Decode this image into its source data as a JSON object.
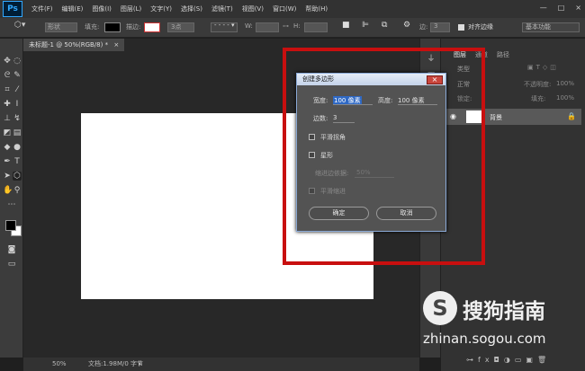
{
  "app": {
    "logo": "Ps",
    "menu": [
      "文件(F)",
      "编辑(E)",
      "图像(I)",
      "图层(L)",
      "文字(Y)",
      "选择(S)",
      "滤镜(T)",
      "视图(V)",
      "窗口(W)",
      "帮助(H)"
    ],
    "window_controls": [
      "—",
      "□",
      "×"
    ]
  },
  "options_bar": {
    "mode_value": "形状",
    "fill_label": "填充:",
    "stroke_label": "描边:",
    "stroke_width": "3点",
    "w_label": "W:",
    "h_label": "H:",
    "edge_label": "边:",
    "edge_value": "3",
    "align_edges_label": "对齐边缘",
    "workspace": "基本功能",
    "fill_color": "#000000"
  },
  "document": {
    "tab_title": "未标题-1 @ 50%(RGB/8) *",
    "tab_close": "×",
    "canvas_color": "#ffffff",
    "zoom": "50%",
    "doc_info": "文档:1.98M/0 字节"
  },
  "panels": {
    "tabs": [
      "图层",
      "通道",
      "路径"
    ],
    "kind_label": "类型",
    "blend_mode": "正常",
    "opacity_label": "不透明度:",
    "opacity_value": "100%",
    "lock_label": "锁定:",
    "fill_label": "填充:",
    "fill_value": "100%",
    "layer_name": "背景"
  },
  "dialog": {
    "title": "创建多边形",
    "close": "×",
    "width_label": "宽度:",
    "width_value": "100 像素",
    "height_label": "高度:",
    "height_value": "100 像素",
    "sides_label": "边数:",
    "sides_value": "3",
    "smooth_corners_label": "平滑拐角",
    "star_label": "星形",
    "indent_label": "缩进边依据:",
    "indent_value": "50%",
    "smooth_indents_label": "平滑缩进",
    "ok_label": "确定",
    "cancel_label": "取消"
  },
  "watermark": {
    "logo_glyph": "S",
    "brand": "搜狗指南",
    "url": "zhinan.sogou.com"
  },
  "colors": {
    "highlight": "#c80f0f",
    "selection": "#2f69c4"
  }
}
